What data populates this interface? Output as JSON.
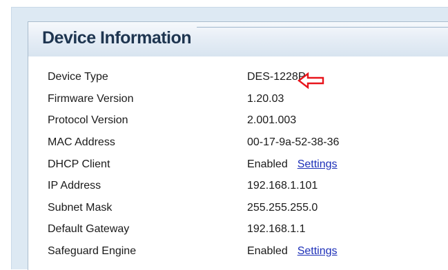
{
  "panel": {
    "title": "Device Information"
  },
  "rows": [
    {
      "label": "Device Type",
      "value": "DES-1228P"
    },
    {
      "label": "Firmware Version",
      "value": "1.20.03"
    },
    {
      "label": "Protocol Version",
      "value": "2.001.003"
    },
    {
      "label": "MAC Address",
      "value": "00-17-9a-52-38-36"
    },
    {
      "label": "DHCP Client",
      "value": "Enabled",
      "link": "Settings"
    },
    {
      "label": "IP Address",
      "value": "192.168.1.101"
    },
    {
      "label": "Subnet Mask",
      "value": "255.255.255.0"
    },
    {
      "label": "Default Gateway",
      "value": "192.168.1.1"
    },
    {
      "label": "Safeguard Engine",
      "value": "Enabled",
      "link": "Settings"
    }
  ],
  "colors": {
    "arrow": "#e8141b",
    "link": "#1c2fb8"
  },
  "icons": {
    "annotation_arrow": "left-arrow-icon"
  }
}
